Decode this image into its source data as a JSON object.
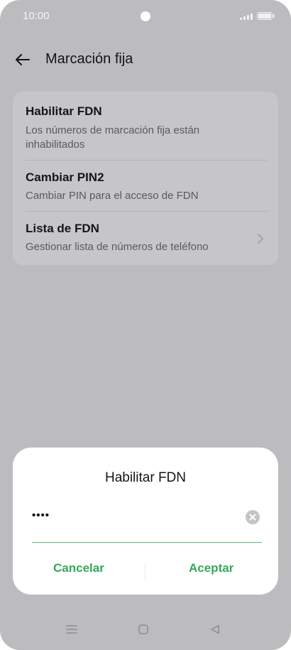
{
  "status_bar": {
    "time": "10:00"
  },
  "app_bar": {
    "title": "Marcación fija"
  },
  "settings": {
    "items": [
      {
        "title": "Habilitar FDN",
        "subtitle": "Los números de marcación fija están inhabilitados"
      },
      {
        "title": "Cambiar PIN2",
        "subtitle": "Cambiar PIN para el acceso de FDN"
      },
      {
        "title": "Lista de FDN",
        "subtitle": "Gestionar lista de números de teléfono"
      }
    ]
  },
  "dialog": {
    "title": "Habilitar FDN",
    "pin_value": "••••",
    "cancel_label": "Cancelar",
    "accept_label": "Aceptar"
  },
  "colors": {
    "accent": "#33a95a",
    "scrim_background": "#bcbcbf",
    "card_background": "#c6c6c9",
    "dialog_background": "#ffffff"
  },
  "icons": {
    "back": "arrow-left-icon",
    "chevron": "chevron-right-icon",
    "clear": "clear-circle-icon",
    "nav": [
      "menu-icon",
      "home-square-icon",
      "back-triangle-icon"
    ]
  }
}
